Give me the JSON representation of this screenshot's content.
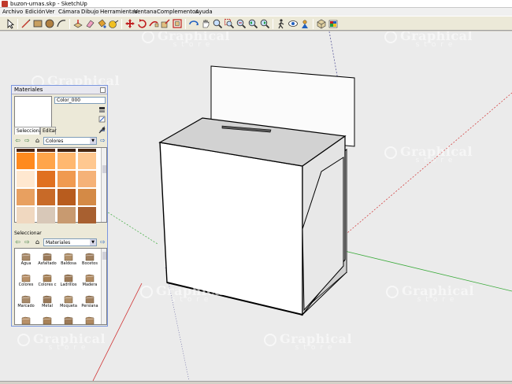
{
  "window": {
    "title": "buzon-urnas.skp - SketchUp"
  },
  "menu": [
    "Archivo",
    "Edición",
    "Ver",
    "Cámara",
    "Dibujo",
    "Herramientas",
    "Ventana",
    "Complementos",
    "Ayuda"
  ],
  "toolbar": {
    "tools": [
      "select-tool",
      "line-tool",
      "rectangle-tool",
      "circle-tool",
      "arc-tool",
      "push-pull-tool",
      "eraser-tool",
      "paint-bucket-tool",
      "tape-measure-tool",
      "move-tool",
      "rotate-tool",
      "follow-me-tool",
      "scale-tool",
      "offset-tool",
      "orbit-tool",
      "pan-tool",
      "zoom-tool",
      "zoom-window-tool",
      "zoom-extents-tool",
      "previous-view-tool",
      "next-view-tool",
      "walk-tool",
      "look-around-tool",
      "position-camera-tool",
      "components-tool",
      "materials-tool",
      "styles-tool",
      "layers-tool"
    ]
  },
  "watermark": {
    "big": "Graphical",
    "small": "store"
  },
  "materials": {
    "panel_title": "Materiales",
    "name_value": "Color_000",
    "tab_select": "Seleccionar",
    "tab_edit": "Editar",
    "collection_top": "Colores",
    "section2_label": "Seleccionar",
    "collection_bottom": "Materiales",
    "swatch_colors": [
      "#4a2410",
      "#5a2a12",
      "#3d2010",
      "#4a2810",
      "#ff8a1e",
      "#ffa54a",
      "#ffb870",
      "#ffc890",
      "#ffe8d0",
      "#e07020",
      "#f09a50",
      "#f5b278",
      "#e8a060",
      "#c86a28",
      "#b85c1e",
      "#d48a46",
      "#f0d8c0",
      "#d8c8b8",
      "#c89a70",
      "#a86030"
    ],
    "items": [
      {
        "label": "Agua",
        "color": "#a88a6a"
      },
      {
        "label": "Asfaltado",
        "color": "#9a7a5a"
      },
      {
        "label": "Baldosa",
        "color": "#b0906a"
      },
      {
        "label": "Bocetos",
        "color": "#a08060"
      },
      {
        "label": "Colores",
        "color": "#b89068"
      },
      {
        "label": "Colores c",
        "color": "#a88258"
      },
      {
        "label": "Ladrillos",
        "color": "#9c7a58"
      },
      {
        "label": "Madera",
        "color": "#b08a62"
      },
      {
        "label": "Marcado",
        "color": "#a88a6a"
      },
      {
        "label": "Metal",
        "color": "#9a7a5a"
      },
      {
        "label": "Moqueta",
        "color": "#b0906a"
      },
      {
        "label": "Persiana",
        "color": "#a08060"
      },
      {
        "label": "",
        "color": "#b89068"
      },
      {
        "label": "",
        "color": "#a88258"
      },
      {
        "label": "",
        "color": "#9c7a58"
      },
      {
        "label": "",
        "color": "#b08a62"
      }
    ]
  }
}
